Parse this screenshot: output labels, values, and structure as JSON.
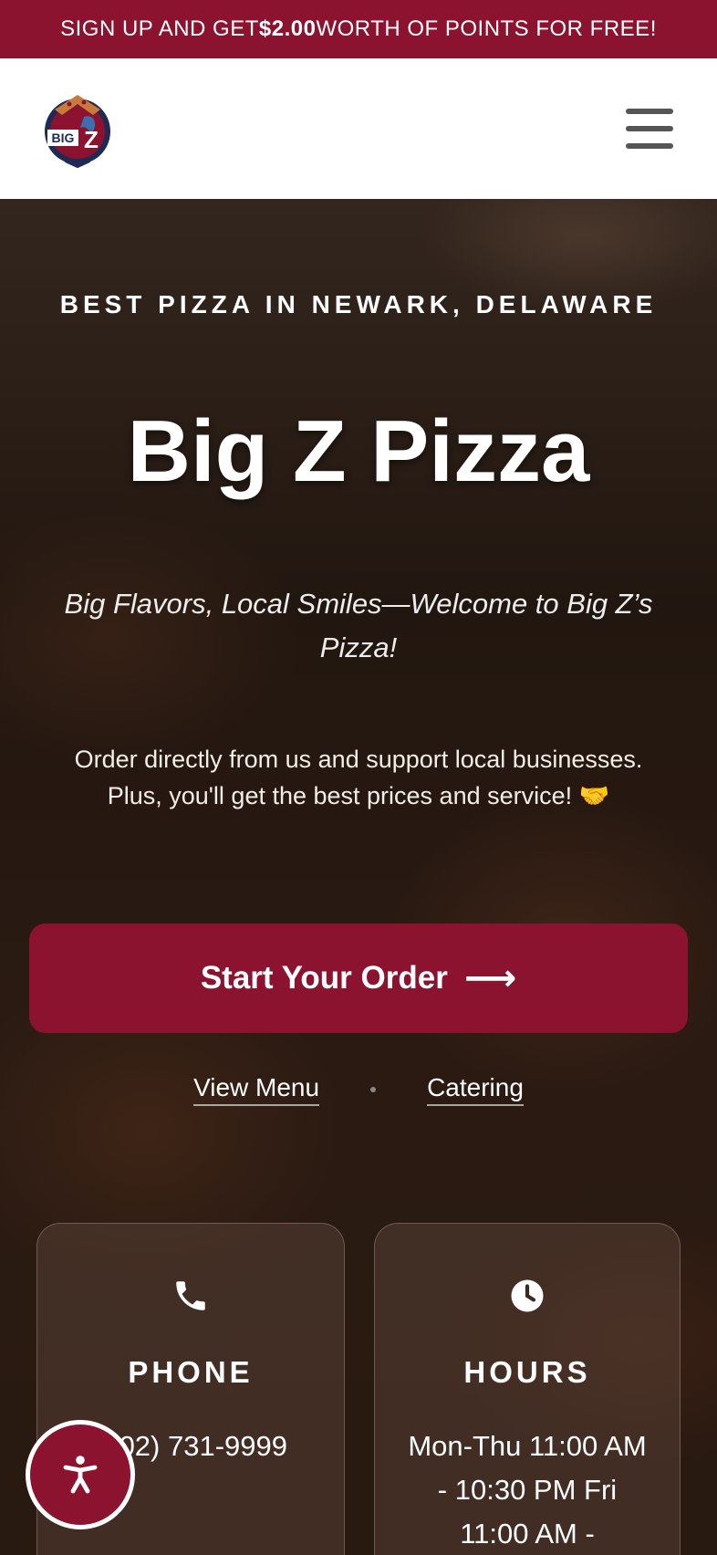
{
  "promo": {
    "prefix": "SIGN UP AND GET ",
    "amount": "$2.00",
    "suffix": " WORTH OF POINTS FOR FREE!"
  },
  "header": {
    "logo_alt": "Big Z",
    "menu_icon": "hamburger-menu-icon"
  },
  "hero": {
    "tagline": "BEST PIZZA IN NEWARK, DELAWARE",
    "title": "Big Z Pizza",
    "subtitle": "Big Flavors, Local Smiles—Welcome to Big Z’s Pizza!",
    "description": "Order directly from us and support local businesses. Plus, you'll get the best prices and service! 🤝",
    "order_button": "Start Your Order",
    "order_arrow": "⟶",
    "links": {
      "menu": "View Menu",
      "catering": "Catering"
    }
  },
  "cards": {
    "phone": {
      "icon": "phone-icon",
      "label": "PHONE",
      "value": "(302) 731-9999"
    },
    "hours": {
      "icon": "clock-icon",
      "label": "HOURS",
      "value": "Mon-Thu 11:00 AM - 10:30 PM Fri 11:00 AM -"
    }
  },
  "accessibility": {
    "icon": "accessibility-icon"
  },
  "colors": {
    "brand": "#8c1330",
    "header_bg": "#ffffff",
    "hero_bg": "#221710"
  }
}
